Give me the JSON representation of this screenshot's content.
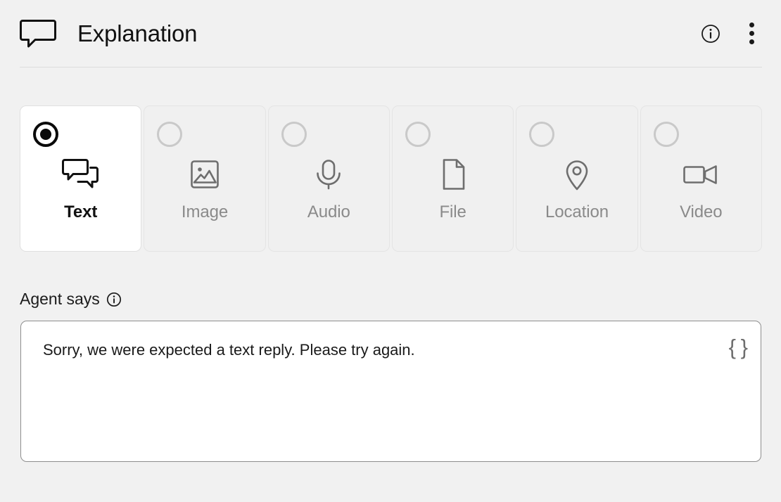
{
  "header": {
    "icon": "speech-bubble-icon",
    "title": "Explanation",
    "info_icon": "info-circle-icon",
    "menu_icon": "kebab-menu-icon"
  },
  "type_selector": {
    "selected": "Text",
    "options": [
      {
        "label": "Text",
        "icon": "chat-bubbles-icon",
        "selected": true
      },
      {
        "label": "Image",
        "icon": "image-icon",
        "selected": false
      },
      {
        "label": "Audio",
        "icon": "microphone-icon",
        "selected": false
      },
      {
        "label": "File",
        "icon": "file-icon",
        "selected": false
      },
      {
        "label": "Location",
        "icon": "map-pin-icon",
        "selected": false
      },
      {
        "label": "Video",
        "icon": "video-camera-icon",
        "selected": false
      }
    ]
  },
  "agent_says": {
    "label": "Agent says",
    "info_icon": "info-filled-icon",
    "value": "Sorry, we were expected a text reply. Please try again.",
    "placeholder": "",
    "braces_icon": "curly-braces-icon",
    "braces_label": "{ }"
  },
  "colors": {
    "background": "#f1f1f1",
    "card_unselected": "#f0f0f0",
    "card_selected": "#ffffff",
    "text_primary": "#111111",
    "text_muted": "#8a8a8a",
    "icon_muted": "#6e6e6e",
    "border": "#e4e4e4",
    "input_border": "#8e8e8e"
  }
}
